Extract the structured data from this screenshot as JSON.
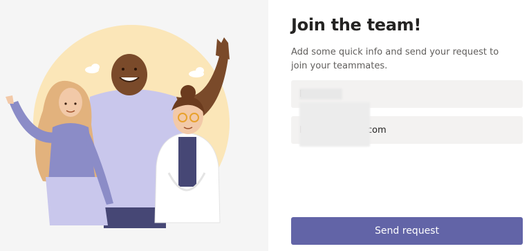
{
  "join_form": {
    "title": "Join the team!",
    "subtitle": "Add some quick info and send your request to join your teammates.",
    "name_value": "F",
    "email_value": "F                    l.com",
    "send_label": "Send request"
  },
  "colors": {
    "accent": "#6264a7",
    "left_background": "#f5f5f5",
    "field_background": "#f3f2f1"
  }
}
